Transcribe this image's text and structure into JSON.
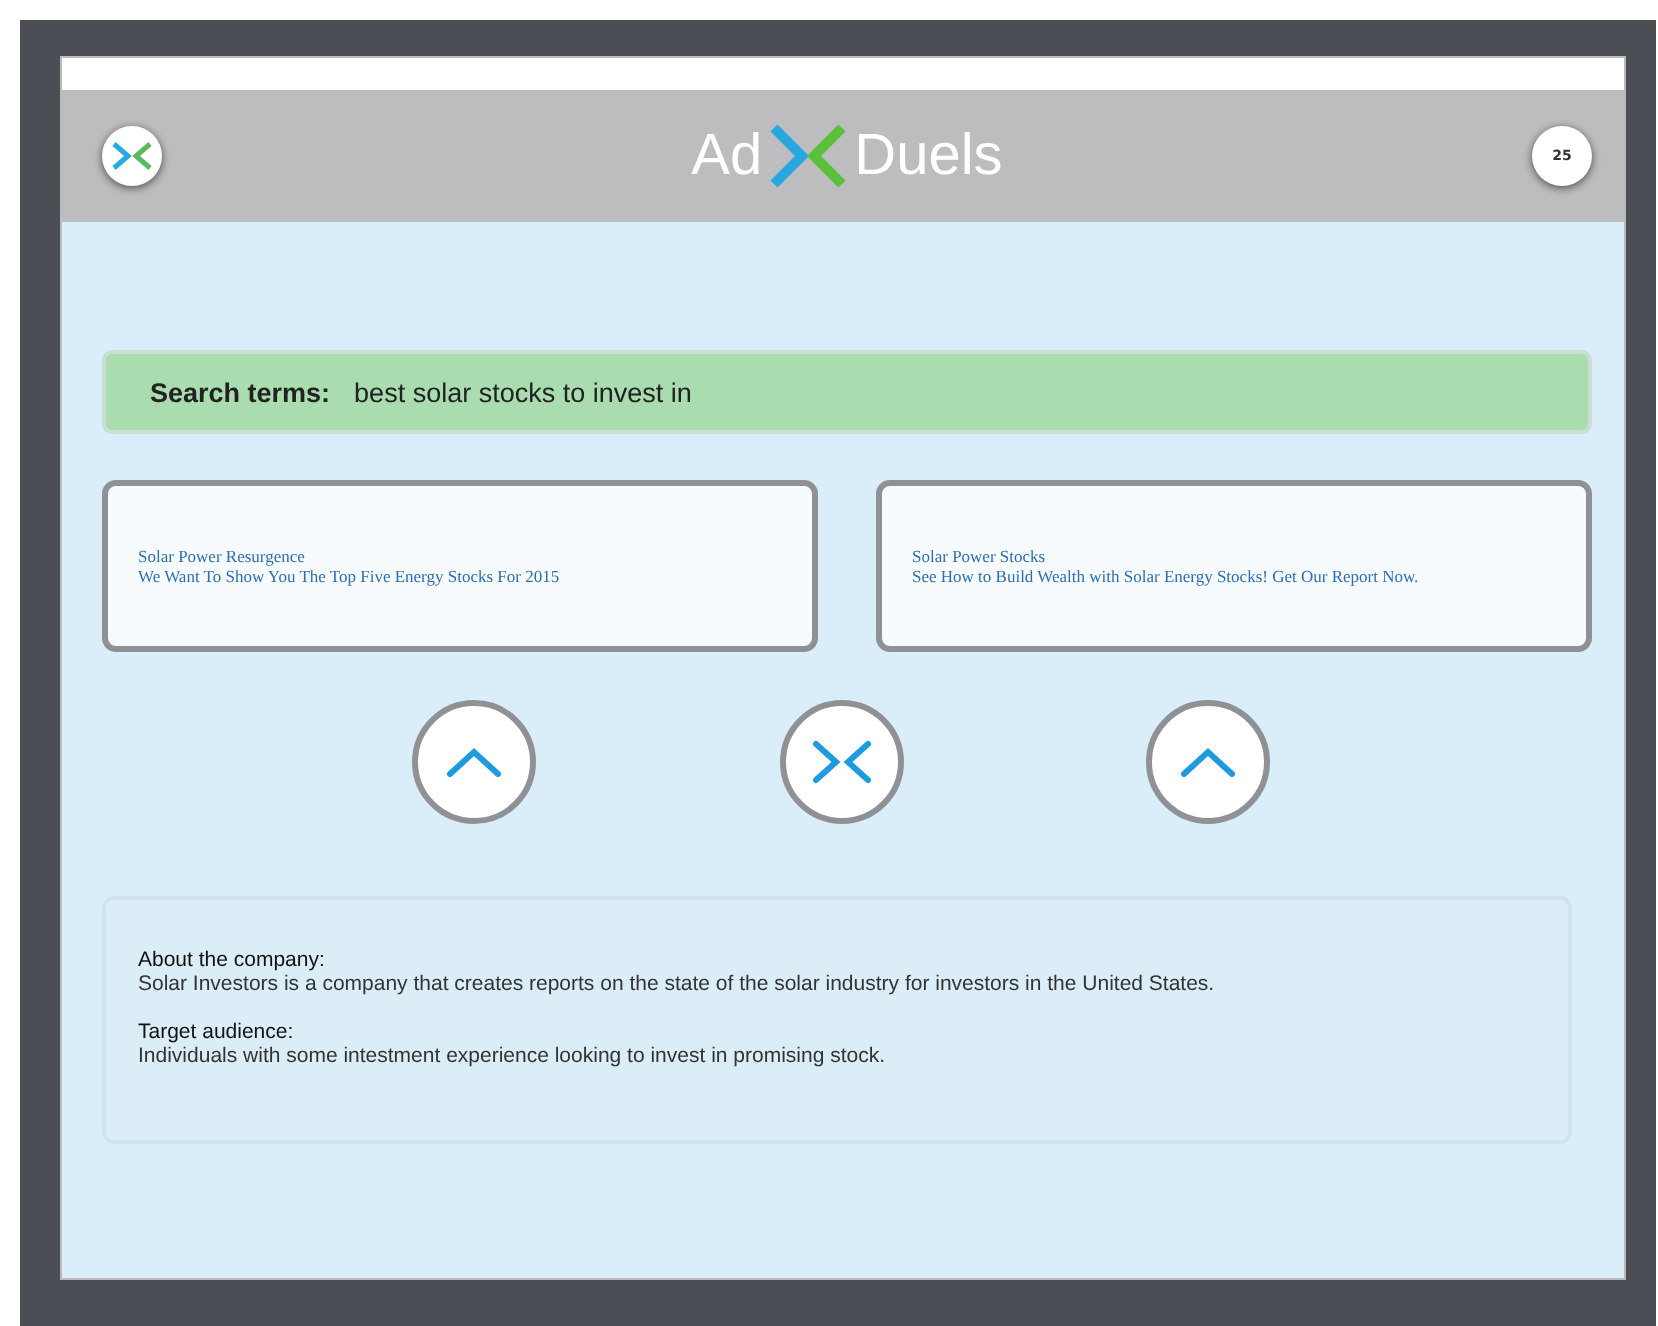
{
  "header": {
    "logo_left": "Ad",
    "logo_right": "Duels",
    "badge": "25"
  },
  "search": {
    "label": "Search terms:",
    "value": "best solar stocks to invest in"
  },
  "ads": [
    {
      "title": "Solar Power Resurgence",
      "description": "We Want To Show You The Top Five Energy Stocks For 2015"
    },
    {
      "title": "Solar Power Stocks",
      "description": "See How to Build Wealth with Solar Energy Stocks! Get Our Report Now."
    }
  ],
  "actions": [
    {
      "kind": "vote"
    },
    {
      "kind": "duel"
    },
    {
      "kind": "vote"
    }
  ],
  "info": [
    {
      "heading": "About the company:",
      "text": "Solar Investors is a company that creates reports on the state of the solar industry for investors in the United States."
    },
    {
      "heading": "Target audience:",
      "text": "Individuals with some intestment experience looking to invest in promising stock."
    }
  ]
}
